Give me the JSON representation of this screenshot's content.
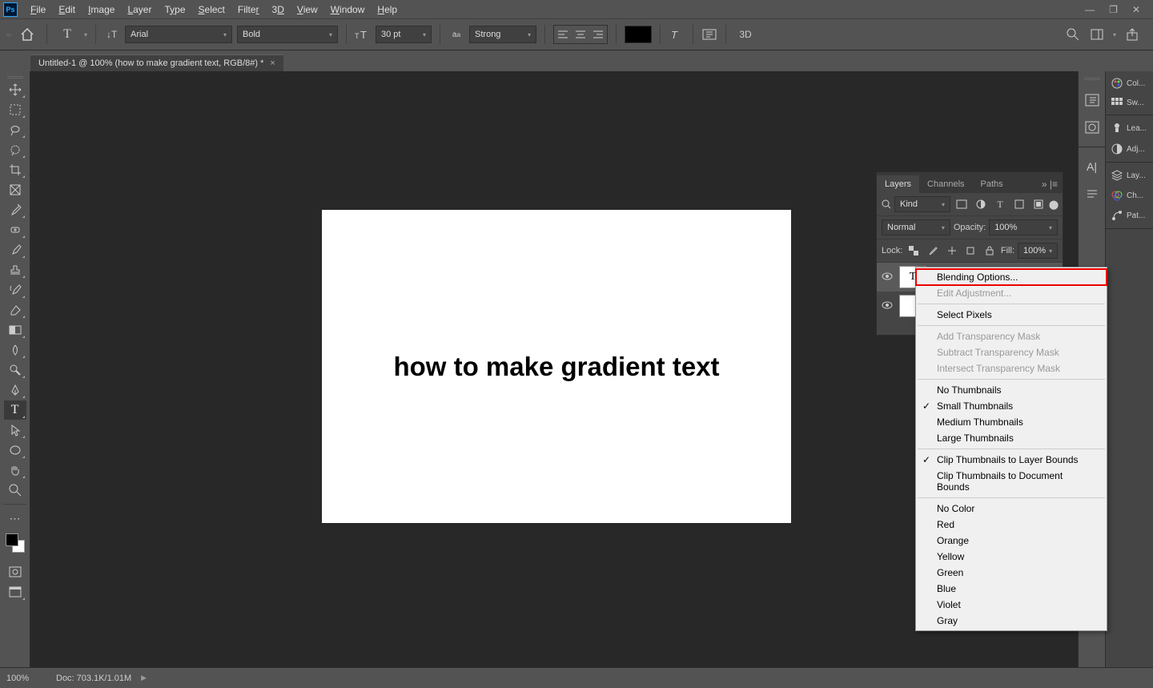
{
  "menu": {
    "items": [
      "File",
      "Edit",
      "Image",
      "Layer",
      "Type",
      "Select",
      "Filter",
      "3D",
      "View",
      "Window",
      "Help"
    ]
  },
  "options": {
    "font": "Arial",
    "weight": "Bold",
    "size": "30 pt",
    "aa": "Strong",
    "threeD": "3D"
  },
  "tab": {
    "title": "Untitled-1 @ 100% (how to make gradient text, RGB/8#) *"
  },
  "canvas": {
    "text": "how to make gradient text"
  },
  "rightPanels": {
    "col": "Col...",
    "sw": "Sw...",
    "lea": "Lea...",
    "adj": "Adj...",
    "lay": "Lay...",
    "ch": "Ch...",
    "pat": "Pat..."
  },
  "layersPanel": {
    "tabs": {
      "layers": "Layers",
      "channels": "Channels",
      "paths": "Paths"
    },
    "kind": "Kind",
    "blend": "Normal",
    "opacityLabel": "Opacity:",
    "opacity": "100%",
    "lockLabel": "Lock:",
    "fillLabel": "Fill:",
    "fill": "100%"
  },
  "context": {
    "blending": "Blending Options...",
    "editAdj": "Edit Adjustment...",
    "selectPixels": "Select Pixels",
    "addMask": "Add Transparency Mask",
    "subMask": "Subtract Transparency Mask",
    "intMask": "Intersect Transparency Mask",
    "noThumb": "No Thumbnails",
    "smThumb": "Small Thumbnails",
    "medThumb": "Medium Thumbnails",
    "lgThumb": "Large Thumbnails",
    "clipLayer": "Clip Thumbnails to Layer Bounds",
    "clipDoc": "Clip Thumbnails to Document Bounds",
    "noColor": "No Color",
    "red": "Red",
    "orange": "Orange",
    "yellow": "Yellow",
    "green": "Green",
    "blue": "Blue",
    "violet": "Violet",
    "gray": "Gray"
  },
  "status": {
    "zoom": "100%",
    "doc": "Doc: 703.1K/1.01M"
  }
}
